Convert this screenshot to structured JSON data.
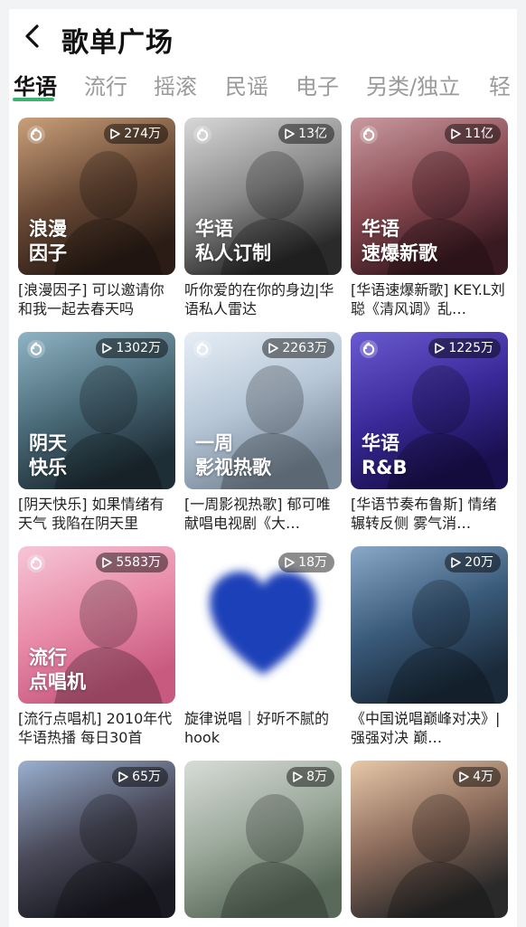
{
  "header": {
    "title": "歌单广场"
  },
  "tabs": [
    "华语",
    "流行",
    "摇滚",
    "民谣",
    "电子",
    "另类/独立",
    "轻"
  ],
  "cards": [
    {
      "count": "274万",
      "label": "浪漫\n因子",
      "caption": "[浪漫因子] 可以邀请你和我一起去春天吗",
      "colors": [
        "#caa07a",
        "#6a4a36",
        "#2b1d16"
      ]
    },
    {
      "count": "13亿",
      "label": "华语\n私人订制",
      "caption": "听你爱的在你的身边|华语私人雷达",
      "colors": [
        "#d8d8d8",
        "#8a8a8a",
        "#2a2a2a"
      ]
    },
    {
      "count": "11亿",
      "label": "华语\n速爆新歌",
      "caption": "[华语速爆新歌] KEY.L刘聪《清风调》乱…",
      "colors": [
        "#c89aa0",
        "#8a4a52",
        "#3a1a22"
      ]
    },
    {
      "count": "1302万",
      "label": "阴天\n快乐",
      "caption": "[阴天快乐] 如果情绪有天气 我陷在阴天里",
      "colors": [
        "#8fb4c4",
        "#4a6a78",
        "#1e2e36"
      ]
    },
    {
      "count": "2263万",
      "label": "一周\n影视热歌",
      "caption": "[一周影视热歌] 郁可唯献唱电视剧《大…",
      "colors": [
        "#e6eef6",
        "#b6c6d6",
        "#7a8a9a"
      ]
    },
    {
      "count": "1225万",
      "label": "华语\nR&B",
      "caption": "[华语节奏布鲁斯] 情绪辗转反侧 雾气消…",
      "colors": [
        "#6a5ad0",
        "#3a2a9a",
        "#1a1050"
      ]
    },
    {
      "count": "5583万",
      "label": "流行\n点唱机",
      "caption": "[流行点唱机] 2010年代华语热播 每日30首",
      "colors": [
        "#f6c6d6",
        "#e88aa8",
        "#c85a80"
      ]
    },
    {
      "count": "18万",
      "label": "",
      "caption": "旋律说唱｜好听不腻的hook",
      "colors": [
        "#ffffff",
        "#ffffff",
        "#ffffff"
      ]
    },
    {
      "count": "20万",
      "label": "",
      "caption": "《中国说唱巅峰对决》|强强对决 巅…",
      "colors": [
        "#8aa8c8",
        "#3a5a7a",
        "#1a2a3a"
      ]
    },
    {
      "count": "65万",
      "label": "",
      "caption": "",
      "colors": [
        "#9ab0d0",
        "#4a4a5a",
        "#1a1a22"
      ]
    },
    {
      "count": "8万",
      "label": "",
      "caption": "",
      "colors": [
        "#d8dcd8",
        "#9aa89a",
        "#5a6a5a"
      ]
    },
    {
      "count": "4万",
      "label": "",
      "caption": "",
      "colors": [
        "#e8c8a8",
        "#8a6a5a",
        "#2a2a2a"
      ]
    }
  ]
}
